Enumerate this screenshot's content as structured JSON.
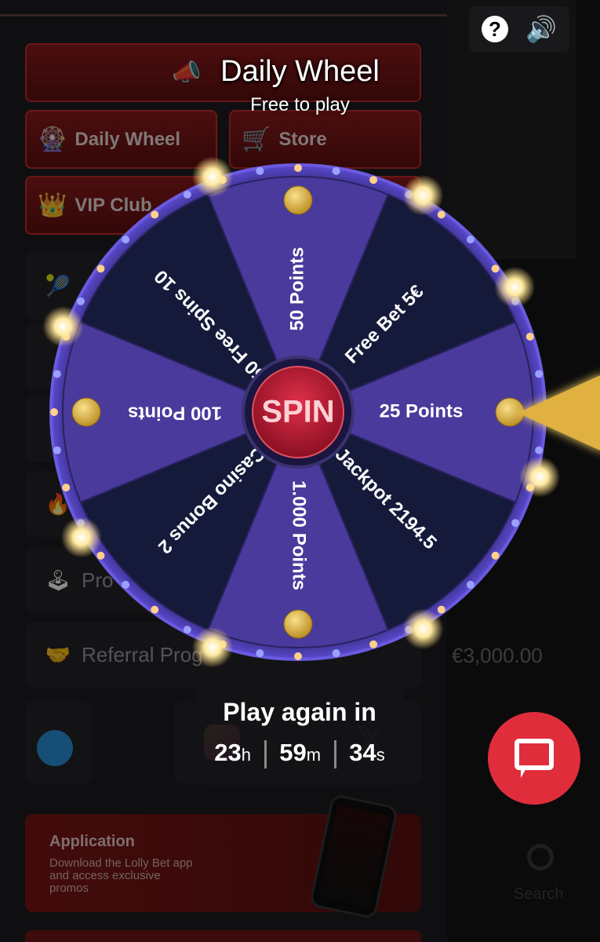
{
  "overlay": {
    "title": "Daily Wheel",
    "subtitle": "Free to play",
    "help_icon": "question-circle-icon",
    "sound_icon": "speaker-icon"
  },
  "background": {
    "buttons": [
      {
        "label": "Daily Wheel",
        "icon": "wheel-icon"
      },
      {
        "label": "Store",
        "icon": "cart-icon"
      },
      {
        "label": "VIP Club",
        "icon": "crown-icon"
      }
    ],
    "menu": [
      {
        "label": "Pro",
        "icon": "joystick-icon"
      },
      {
        "label": "Referral Prog",
        "icon": "handshake-icon"
      }
    ],
    "app_card": {
      "title": "Application",
      "description": "Download the Lolly Bet app and access exclusive promos"
    },
    "right_amount": "€3,000.00",
    "search_label": "Search"
  },
  "wheel": {
    "center_label": "SPIN",
    "segments": [
      {
        "label": "25 Points",
        "color": "#4a3a9c"
      },
      {
        "label": "Jackpot 2194.5",
        "color": "#151a3a"
      },
      {
        "label": "1.000 Points",
        "color": "#4a3a9c"
      },
      {
        "label": "Casino Bonus 2",
        "color": "#151a3a"
      },
      {
        "label": "100 Points",
        "color": "#4a3a9c"
      },
      {
        "label": "50 Free Spins 10",
        "color": "#151a3a"
      },
      {
        "label": "50 Points",
        "color": "#4a3a9c"
      },
      {
        "label": "Free Bet 5€",
        "color": "#151a3a"
      }
    ]
  },
  "timer": {
    "label": "Play again in",
    "hours": "23",
    "minutes": "59",
    "seconds": "34",
    "h_unit": "h",
    "m_unit": "m",
    "s_unit": "s"
  },
  "chat_icon": "chat-bubble-icon"
}
